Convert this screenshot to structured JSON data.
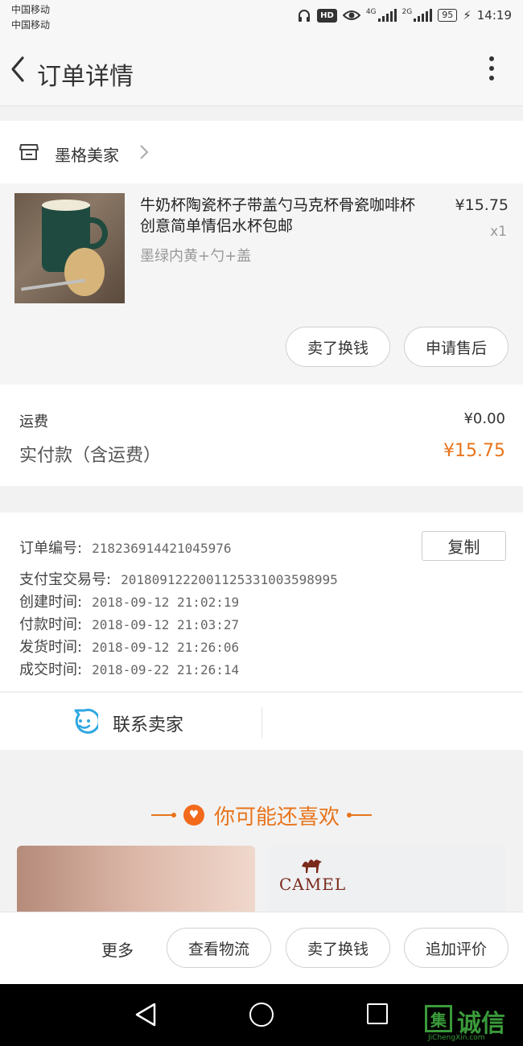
{
  "status_bar": {
    "carrier1": "中国移动",
    "carrier2": "中国移动",
    "hd": "HD",
    "net1": "4G",
    "net2": "2G",
    "battery": "95",
    "time": "14:19"
  },
  "nav": {
    "title": "订单详情"
  },
  "store": {
    "name": "墨格美家"
  },
  "product": {
    "title": "牛奶杯陶瓷杯子带盖勺马克杯骨瓷咖啡杯创意简单情侣水杯包邮",
    "sku": "墨绿内黄+勺+盖",
    "price": "¥15.75",
    "qty": "x1",
    "btn_sell": "卖了换钱",
    "btn_after_sale": "申请售后"
  },
  "fees": {
    "shipping_label": "运费",
    "shipping_value": "¥0.00",
    "paid_label": "实付款（含运费）",
    "paid_value": "¥15.75"
  },
  "order_info": {
    "copy_label": "复制",
    "rows": [
      {
        "label": "订单编号:",
        "value": "218236914421045976"
      },
      {
        "label": "支付宝交易号:",
        "value": "2018091222001125331003598995"
      },
      {
        "label": "创建时间:",
        "value": "2018-09-12 21:02:19"
      },
      {
        "label": "付款时间:",
        "value": "2018-09-12 21:03:27"
      },
      {
        "label": "发货时间:",
        "value": "2018-09-12 21:26:06"
      },
      {
        "label": "成交时间:",
        "value": "2018-09-22 21:26:14"
      }
    ]
  },
  "contact": {
    "label": "联系卖家"
  },
  "recommend": {
    "title": "你可能还喜欢",
    "brand": "CAMEL"
  },
  "bottom_bar": {
    "more": "更多",
    "btn_logistics": "查看物流",
    "btn_sell": "卖了换钱",
    "btn_review": "追加评价"
  },
  "watermark": {
    "box": "集",
    "text": "诚信",
    "url": "JiChengXin.com"
  },
  "colors": {
    "accent": "#e8741c",
    "contact_icon": "#2ea7e0",
    "watermark": "#3a9a3a"
  }
}
